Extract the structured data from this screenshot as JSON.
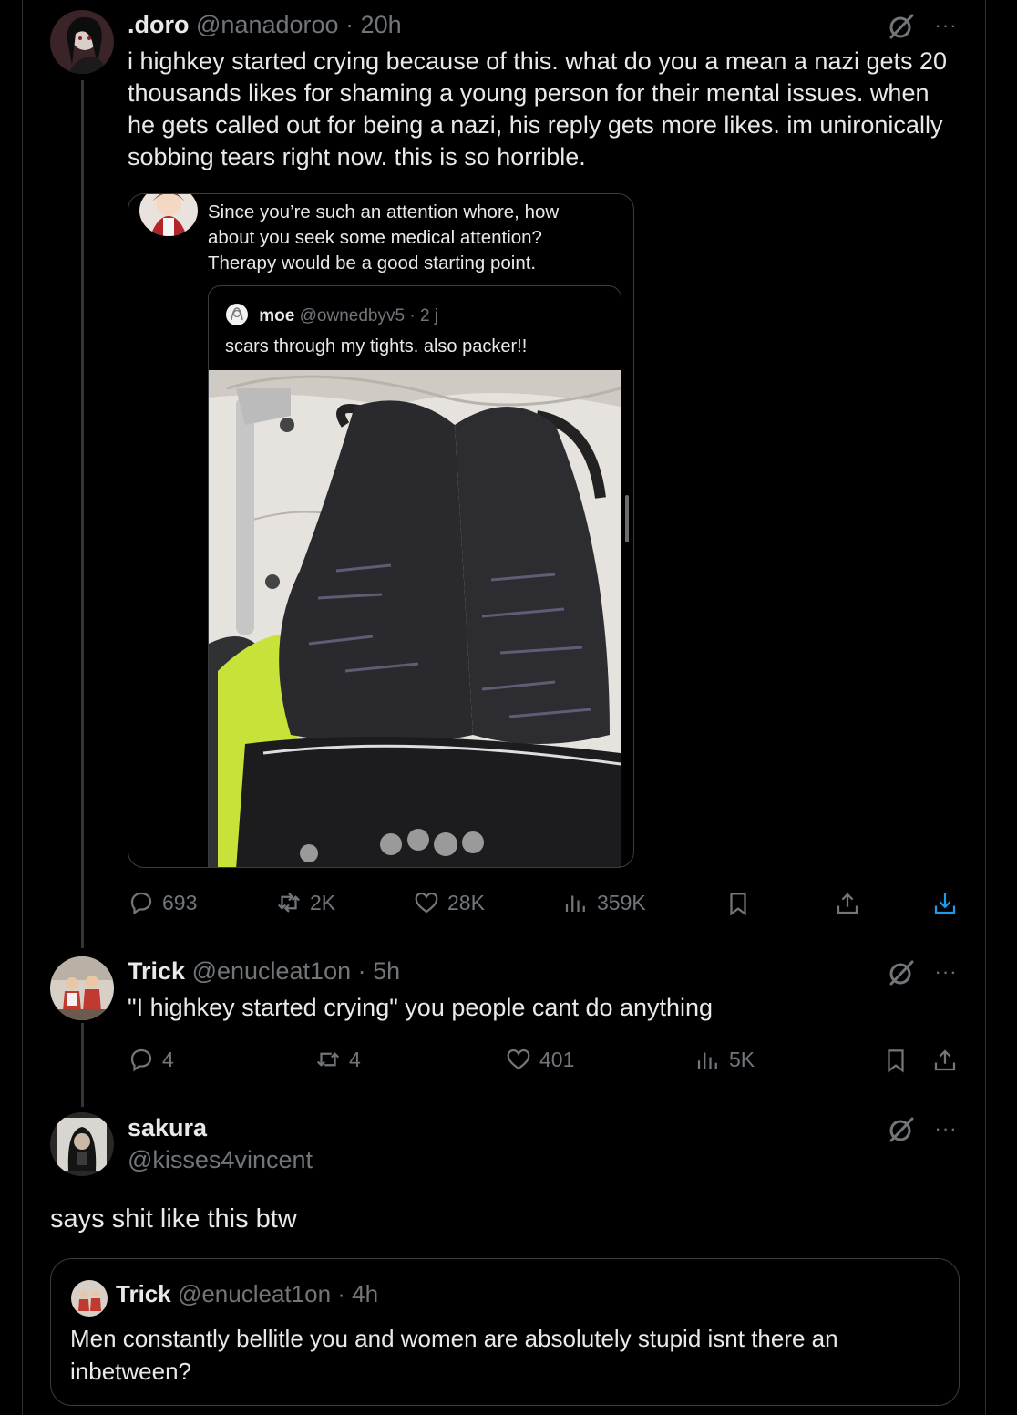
{
  "post1": {
    "display_name": ".doro",
    "handle": "@nanadoroo",
    "time": "· 20h",
    "text": "i highkey started crying because of this. what do you a mean a nazi gets 20 thousands likes for shaming a young person for their mental issues. when he gets called out for being a nazi, his reply gets more likes. im unironically sobbing tears right now.  this is so horrible.",
    "embedded": {
      "reply_text": "Since you’re such an attention whore, how about you seek some medical attention? Therapy would be a good starting point.",
      "quote": {
        "display_name": "moe",
        "handle": "@ownedbyv5",
        "time": "· 2 j",
        "text": "scars through my tights. also packer!!"
      }
    },
    "stats": {
      "replies": "693",
      "reposts": "2K",
      "likes": "28K",
      "views": "359K"
    }
  },
  "post2": {
    "display_name": "Trick",
    "handle": "@enucleat1on",
    "time": "· 5h",
    "text": "\"I highkey started crying\" you people cant do anything",
    "stats": {
      "replies": "4",
      "reposts": "4",
      "likes": "401",
      "views": "5K"
    }
  },
  "post3": {
    "display_name": "sakura",
    "handle": "@kisses4vincent",
    "text": "says shit like this btw",
    "quote": {
      "display_name": "Trick",
      "handle": "@enucleat1on",
      "time": "· 4h",
      "text": "Men constantly bellitle you and women are absolutely stupid isnt there an inbetween?"
    }
  },
  "icons": {
    "more": "more-options-icon",
    "grok": "grok-icon",
    "reply": "reply-icon",
    "repost": "repost-icon",
    "like": "like-icon",
    "views": "views-icon",
    "bookmark": "bookmark-icon",
    "share": "share-icon",
    "download": "download-icon"
  },
  "more_label": "···",
  "colors": {
    "background": "#000000",
    "text": "#e7e9ea",
    "secondary": "#71767b",
    "border": "#2f3336"
  }
}
